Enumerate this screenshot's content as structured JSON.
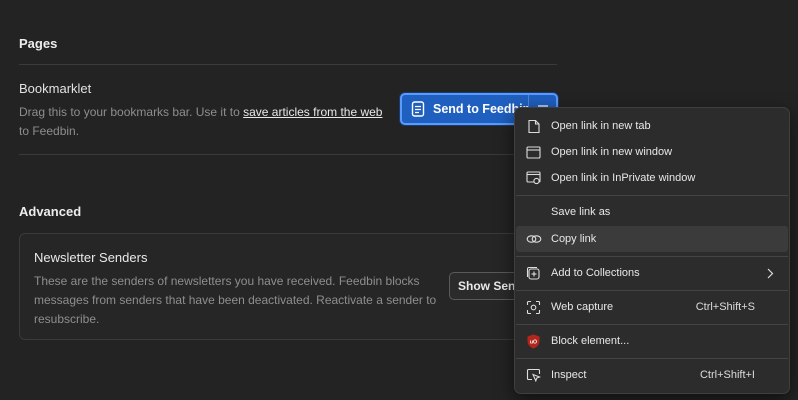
{
  "pages": {
    "title": "Pages",
    "bookmarklet": {
      "title": "Bookmarklet",
      "desc_prefix": "Drag this to your bookmarks bar. Use it to ",
      "desc_link": "save articles from the web",
      "desc_suffix": " to Feedbin.",
      "button_label": "Send to Feedbin"
    }
  },
  "advanced": {
    "title": "Advanced",
    "newsletter": {
      "title": "Newsletter Senders",
      "desc": "These are the senders of newsletters you have received. Feedbin blocks messages from senders that have been deactivated. Reactivate a sender to resubscribe.",
      "button_label": "Show Senders"
    }
  },
  "context_menu": {
    "items": [
      {
        "label": "Open link in new tab",
        "icon": "new-tab-icon"
      },
      {
        "label": "Open link in new window",
        "icon": "new-window-icon"
      },
      {
        "label": "Open link in InPrivate window",
        "icon": "inprivate-icon"
      },
      {
        "label": "Save link as",
        "icon": ""
      },
      {
        "label": "Copy link",
        "icon": "link-icon"
      },
      {
        "label": "Add to Collections",
        "icon": "collections-icon"
      },
      {
        "label": "Web capture",
        "icon": "capture-icon",
        "shortcut": "Ctrl+Shift+S"
      },
      {
        "label": "Block element...",
        "icon": "ublock-icon"
      },
      {
        "label": "Inspect",
        "icon": "inspect-icon",
        "shortcut": "Ctrl+Shift+I"
      }
    ],
    "highlighted": "Copy link"
  },
  "colors": {
    "background": "#232323",
    "accent": "#1f5fbf",
    "menu_bg": "#2c2c2c",
    "ublock_red": "#b3261e"
  }
}
